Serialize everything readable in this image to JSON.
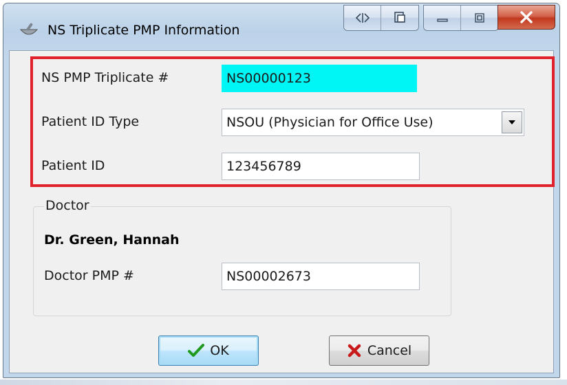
{
  "window": {
    "title": "NS Triplicate PMP Information",
    "controls": {
      "restore_split": "⧉",
      "copy": "copy",
      "minimize": "minimize",
      "maximize": "maximize",
      "close": "close"
    }
  },
  "form": {
    "triplicate_label": "NS PMP Triplicate #",
    "triplicate_value": "NS00000123",
    "patient_id_type_label": "Patient ID Type",
    "patient_id_type_value": "NSOU (Physician for Office Use)",
    "patient_id_label": "Patient ID",
    "patient_id_value": "123456789"
  },
  "doctor": {
    "group_label": "Doctor",
    "name": "Dr. Green, Hannah",
    "pmp_label": "Doctor PMP #",
    "pmp_value": "NS00002673"
  },
  "buttons": {
    "ok": "OK",
    "cancel": "Cancel"
  },
  "icons": {
    "app": "mortar-pestle-icon",
    "ok": "checkmark-icon",
    "cancel": "x-icon",
    "dropdown": "chevron-down-icon"
  },
  "colors": {
    "highlight_border": "#e0202a",
    "cyan_field": "#00f5f5",
    "ok_check": "#1f9a1f",
    "cancel_x": "#c81a1a"
  }
}
